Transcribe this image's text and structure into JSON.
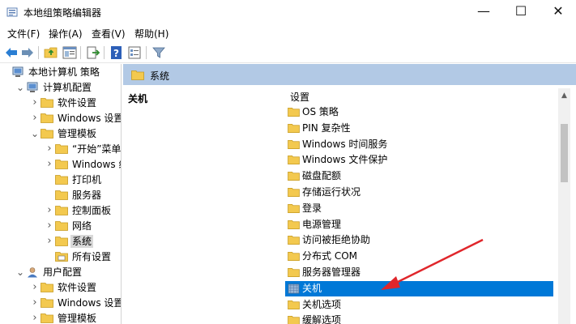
{
  "window": {
    "title": "本地组策略编辑器",
    "minimize_glyph": "—",
    "maximize_glyph": "☐",
    "close_glyph": "✕"
  },
  "menu": [
    {
      "label": "文件(F)"
    },
    {
      "label": "操作(A)"
    },
    {
      "label": "查看(V)"
    },
    {
      "label": "帮助(H)"
    }
  ],
  "toolbar": {
    "buttons": [
      "back-arrow-icon",
      "forward-arrow-icon",
      "up-folder-icon",
      "show-hide-tree-icon",
      "export-list-icon",
      "help-icon",
      "properties-icon",
      "filter-icon"
    ]
  },
  "tree": [
    {
      "label": "本地计算机 策略",
      "icon": "computer-policy-icon",
      "level": 0,
      "arrow": ""
    },
    {
      "label": "计算机配置",
      "icon": "computer-icon",
      "level": 1,
      "arrow": "down"
    },
    {
      "label": "软件设置",
      "icon": "folder-icon",
      "level": 2,
      "arrow": "right"
    },
    {
      "label": "Windows 设置",
      "icon": "folder-icon",
      "level": 2,
      "arrow": "right"
    },
    {
      "label": "管理模板",
      "icon": "folder-icon",
      "level": 2,
      "arrow": "down"
    },
    {
      "label": "“开始”菜单和",
      "icon": "folder-icon",
      "level": 3,
      "arrow": "right"
    },
    {
      "label": "Windows 组",
      "icon": "folder-icon",
      "level": 3,
      "arrow": "right"
    },
    {
      "label": "打印机",
      "icon": "folder-icon",
      "level": 3,
      "arrow": ""
    },
    {
      "label": "服务器",
      "icon": "folder-icon",
      "level": 3,
      "arrow": ""
    },
    {
      "label": "控制面板",
      "icon": "folder-icon",
      "level": 3,
      "arrow": "right"
    },
    {
      "label": "网络",
      "icon": "folder-icon",
      "level": 3,
      "arrow": "right"
    },
    {
      "label": "系统",
      "icon": "folder-icon",
      "level": 3,
      "arrow": "right",
      "selected": true
    },
    {
      "label": "所有设置",
      "icon": "settings-folder-icon",
      "level": 3,
      "arrow": ""
    },
    {
      "label": "用户配置",
      "icon": "user-icon",
      "level": 1,
      "arrow": "down"
    },
    {
      "label": "软件设置",
      "icon": "folder-icon",
      "level": 2,
      "arrow": "right"
    },
    {
      "label": "Windows 设置",
      "icon": "folder-icon",
      "level": 2,
      "arrow": "right"
    },
    {
      "label": "管理模板",
      "icon": "folder-icon",
      "level": 2,
      "arrow": "right"
    }
  ],
  "right_pane": {
    "header_title": "系统",
    "description_title": "关机",
    "list_header": "设置",
    "items": [
      {
        "label": "OS 策略"
      },
      {
        "label": "PIN 复杂性"
      },
      {
        "label": "Windows 时间服务"
      },
      {
        "label": "Windows 文件保护"
      },
      {
        "label": "磁盘配额"
      },
      {
        "label": "存储运行状况"
      },
      {
        "label": "登录"
      },
      {
        "label": "电源管理"
      },
      {
        "label": "访问被拒绝协助"
      },
      {
        "label": "分布式 COM"
      },
      {
        "label": "服务器管理器"
      },
      {
        "label": "关机",
        "selected": true
      },
      {
        "label": "关机选项"
      },
      {
        "label": "缓解选项"
      }
    ]
  },
  "colors": {
    "selection": "#0078d7",
    "header_bar": "#b2c9e5",
    "folder": "#f3c94f",
    "annotation_arrow": "#e0262b"
  }
}
